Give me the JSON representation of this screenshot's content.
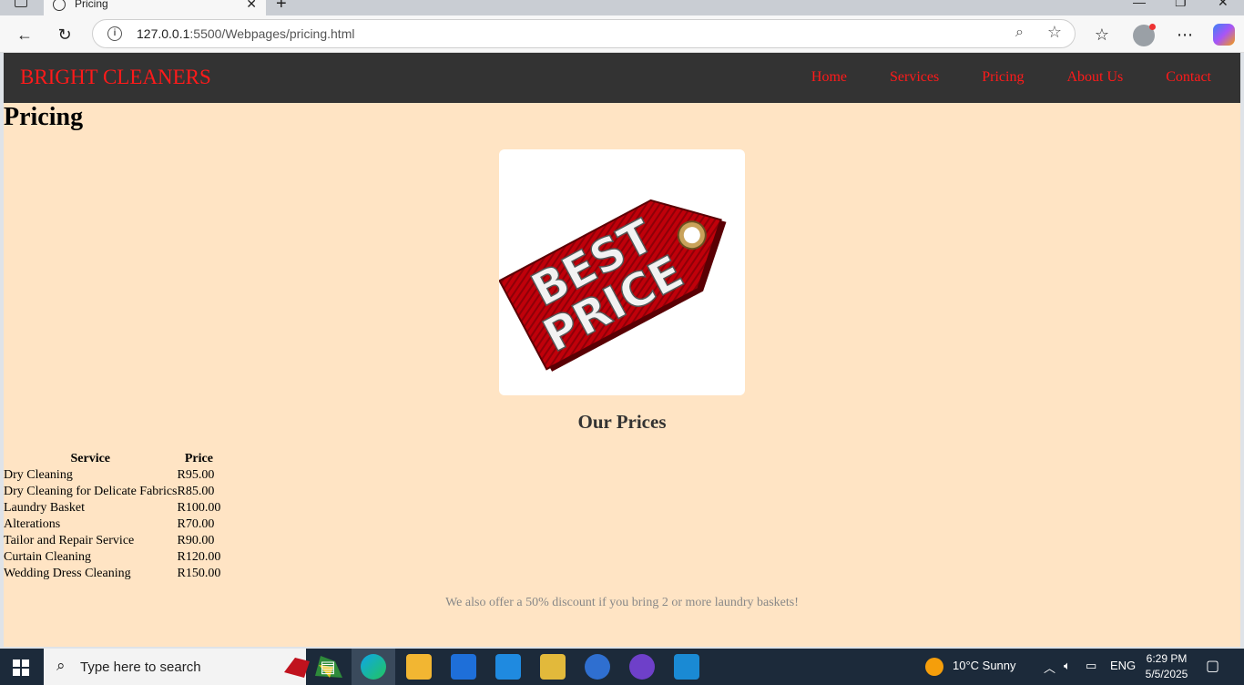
{
  "browser": {
    "tab_title": "Pricing",
    "url_host": "127.0.0.1",
    "url_rest": ":5500/Webpages/pricing.html"
  },
  "site": {
    "brand": "BRIGHT CLEANERS",
    "nav": [
      "Home",
      "Services",
      "Pricing",
      "About Us",
      "Contact"
    ],
    "colors": {
      "nav_bg": "#333333",
      "nav_text": "#ff1a1a",
      "page_bg": "#ffe4c4"
    }
  },
  "page": {
    "title": "Pricing",
    "image": {
      "line1": "BEST",
      "line2": "PRICE"
    },
    "section_title": "Our Prices",
    "table": {
      "headers": [
        "Service",
        "Price"
      ],
      "rows": [
        [
          "Dry Cleaning",
          "R95.00"
        ],
        [
          "Dry Cleaning for Delicate Fabrics",
          "R85.00"
        ],
        [
          "Laundry Basket",
          "R100.00"
        ],
        [
          "Alterations",
          "R70.00"
        ],
        [
          "Tailor and Repair Service",
          "R90.00"
        ],
        [
          "Curtain Cleaning",
          "R120.00"
        ],
        [
          "Wedding Dress Cleaning",
          "R150.00"
        ]
      ]
    },
    "discount_note": "We also offer a 50% discount if you bring 2 or more laundry baskets!"
  },
  "taskbar": {
    "search_placeholder": "Type here to search",
    "weather": "10°C  Sunny",
    "language": "ENG",
    "time": "6:29 PM",
    "date": "5/5/2025"
  }
}
